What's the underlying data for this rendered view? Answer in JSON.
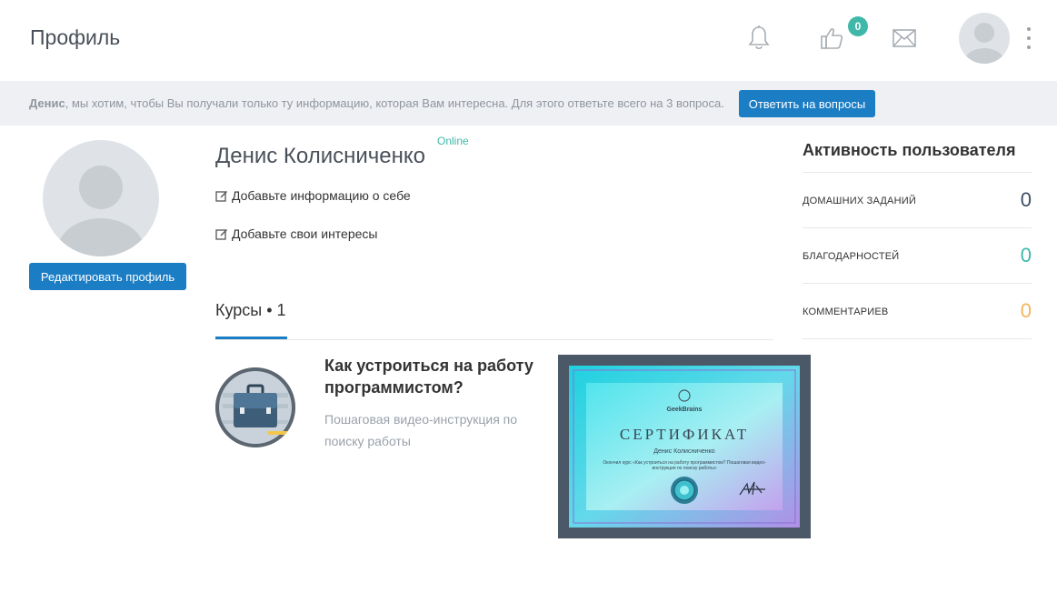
{
  "header": {
    "title": "Профиль",
    "likes_count": "0"
  },
  "notice": {
    "name": "Денис",
    "text": ", мы хотим, чтобы Вы получали только ту информацию, которая Вам интересна. Для этого ответьте всего на 3 вопроса.",
    "button_label": "Ответить на вопросы"
  },
  "profile": {
    "edit_label": "Редактировать профиль",
    "name": "Денис Колисниченко",
    "status": "Online",
    "add_info_label": "Добавьте информацию о себе",
    "add_interests_label": "Добавьте свои интересы"
  },
  "courses": {
    "tab_label": "Курсы • 1",
    "items": [
      {
        "title": "Как устроиться на работу программистом?",
        "description": "Пошаговая видео-инструкция по поиску работы"
      }
    ]
  },
  "certificate": {
    "brand": "GeekBrains",
    "heading": "СЕРТИФИКАТ",
    "recipient": "Денис Колисниченко",
    "text": "Окончил курс «Как устроиться на работу программистом? Пошаговая видео-инструкция по поиску работы»"
  },
  "activity": {
    "title": "Активность пользователя",
    "items": [
      {
        "label": "ДОМАШНИХ ЗАДАНИЙ",
        "value": "0",
        "color": "#3d4f63"
      },
      {
        "label": "БЛАГОДАРНОСТЕЙ",
        "value": "0",
        "color": "#3fb8a9"
      },
      {
        "label": "КОММЕНТАРИЕВ",
        "value": "0",
        "color": "#f2b55a"
      }
    ]
  },
  "colors": {
    "accent": "#1b7dc4",
    "online": "#3fb8a9"
  },
  "icons": [
    "bell-icon",
    "thumbs-up-icon",
    "envelope-icon",
    "kebab-menu-icon",
    "edit-icon",
    "briefcase-icon"
  ]
}
